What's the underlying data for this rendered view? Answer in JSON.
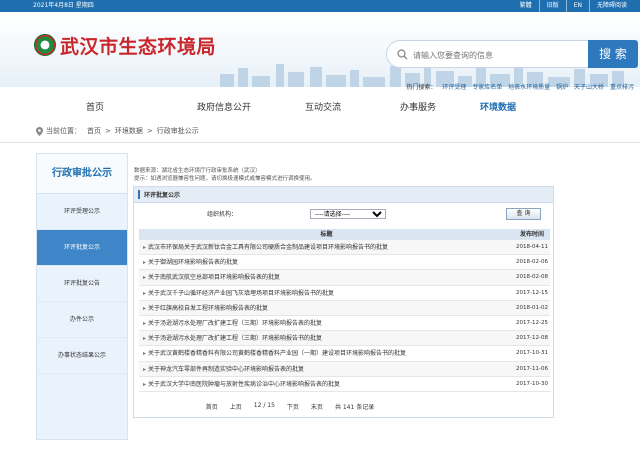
{
  "topbar": {
    "date": "2021年4月8日 星期四",
    "links": [
      "繁體",
      "旧版",
      "EN",
      "无障碍阅读"
    ]
  },
  "header": {
    "site_name": "武汉市生态环境局",
    "search_placeholder": "请输入您要查询的信息",
    "search_button": "搜 索",
    "hot_label": "热门搜索：",
    "hot_words": [
      "环评受理",
      "专家库名单",
      "地表水环境质量",
      "锅炉",
      "天子山大桥",
      "重点排污"
    ]
  },
  "nav": {
    "items": [
      "首页",
      "政府信息公开",
      "互动交流",
      "办事服务",
      "环境数据"
    ],
    "active_index": 4
  },
  "breadcrumb": {
    "prefix": "当前位置：",
    "items": [
      "首页",
      "环境数据",
      "行政审批公示"
    ]
  },
  "sidebar": {
    "title": "行政审批公示",
    "items": [
      "环评受理公示",
      "环评批复公示",
      "环评批复公告",
      "办件公示",
      "办事状态结果公示"
    ],
    "active_index": 1
  },
  "notice": {
    "line1": "数据来源：湖北省生态环境厅行政审批系统（武汉）",
    "line2": "提示：如遇浏览器兼容性问题，请切换极速模式或兼容模式进行调换使用。"
  },
  "panel": {
    "tab_label": "环评批复公示",
    "filter_label": "组织机构：",
    "filter_value": "----请选择----",
    "query_button": "查 询",
    "col_title": "标题",
    "col_date": "发布时间",
    "rows": [
      {
        "title": "武汉市环保局关于武汉新钛合金工具有限公司硬质合金制品建设项目环境影响报告书的批复",
        "date": "2018-04-11"
      },
      {
        "title": "关于御湖园环境影响报告表的批复",
        "date": "2018-02-06"
      },
      {
        "title": "关于南航武汉航空总部项目环境影响报告表的批复",
        "date": "2018-02-08"
      },
      {
        "title": "关于武汉千子山循环经济产业园飞灰填埋场项目环境影响报告书的批复",
        "date": "2017-12-15"
      },
      {
        "title": "关于红旗高校自发工程环境影响报告表的批复",
        "date": "2018-01-02"
      },
      {
        "title": "关于汤逊湖污水处理厂改扩建工程（三期）环境影响报告表的批复",
        "date": "2017-12-25"
      },
      {
        "title": "关于汤逊湖污水处理厂改扩建工程（三期）环境影响报告书的批复",
        "date": "2017-12-08"
      },
      {
        "title": "关于武汉黄鹤楼香精香料有限公司黄鹤楼香精香料产业园（一期）建设项目环境影响报告书的批复",
        "date": "2017-10-31"
      },
      {
        "title": "关于神龙汽车零部件再制造实验中心环境影响报告表的批复",
        "date": "2017-11-06"
      },
      {
        "title": "关于武汉大学中南医院肿瘤与放射性疾病诊治中心环境影响报告表的批复",
        "date": "2017-10-30"
      }
    ]
  },
  "pager": {
    "first": "首页",
    "prev": "上页",
    "current": "12 / 15",
    "next": "下页",
    "last": "末页",
    "total": "共 141 条记录"
  },
  "colors": {
    "brand_blue": "#1f6fb0",
    "logo_red": "#c8262b",
    "sidebar_active": "#3f86c8"
  }
}
